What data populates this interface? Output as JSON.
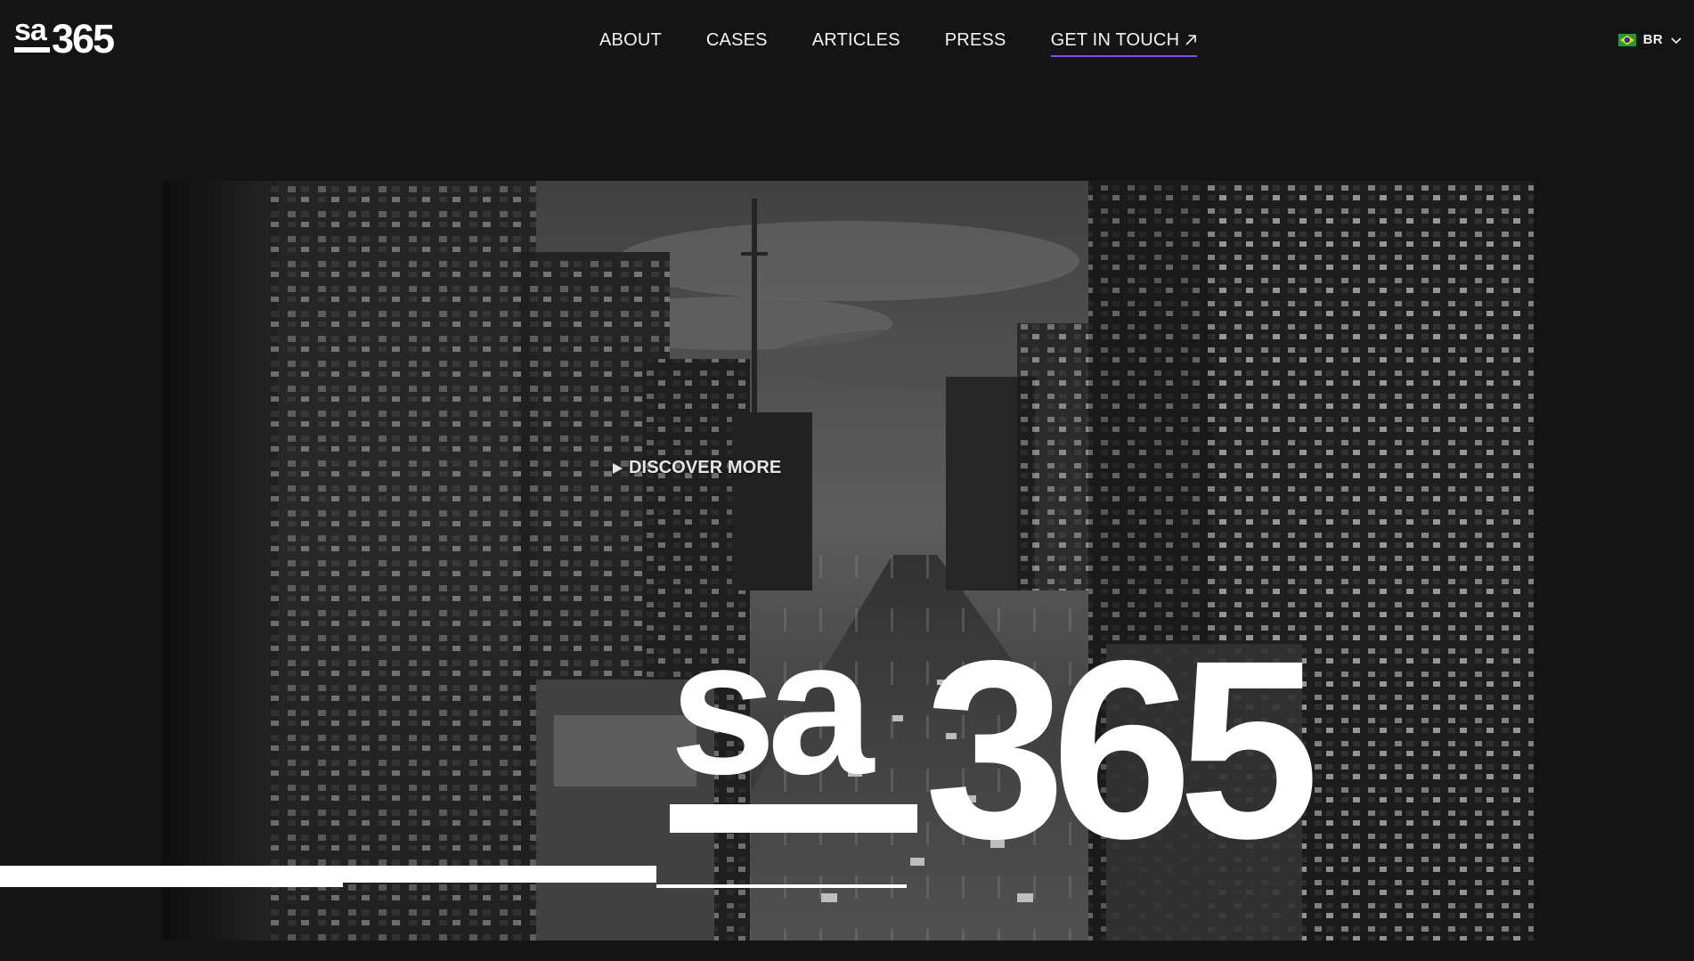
{
  "brand": {
    "logo_text": "sa365",
    "logo_icon": "sa365-logo"
  },
  "nav": {
    "items": [
      {
        "label": "ABOUT"
      },
      {
        "label": "CASES"
      },
      {
        "label": "ARTICLES"
      },
      {
        "label": "PRESS"
      },
      {
        "label": "GET IN TOUCH",
        "icon": "arrow-up-right-icon"
      }
    ],
    "accent_color": "#7b4dff"
  },
  "language": {
    "code": "BR",
    "flag_icon": "brazil-flag-icon",
    "dropdown_icon": "chevron-down-icon"
  },
  "hero": {
    "discover_label": "DISCOVER MORE",
    "discover_icon": "play-icon",
    "logo_text": "sa365",
    "background": "city-avenue-night-photo"
  },
  "colors": {
    "background": "#141414",
    "text": "#f2f2f2"
  }
}
